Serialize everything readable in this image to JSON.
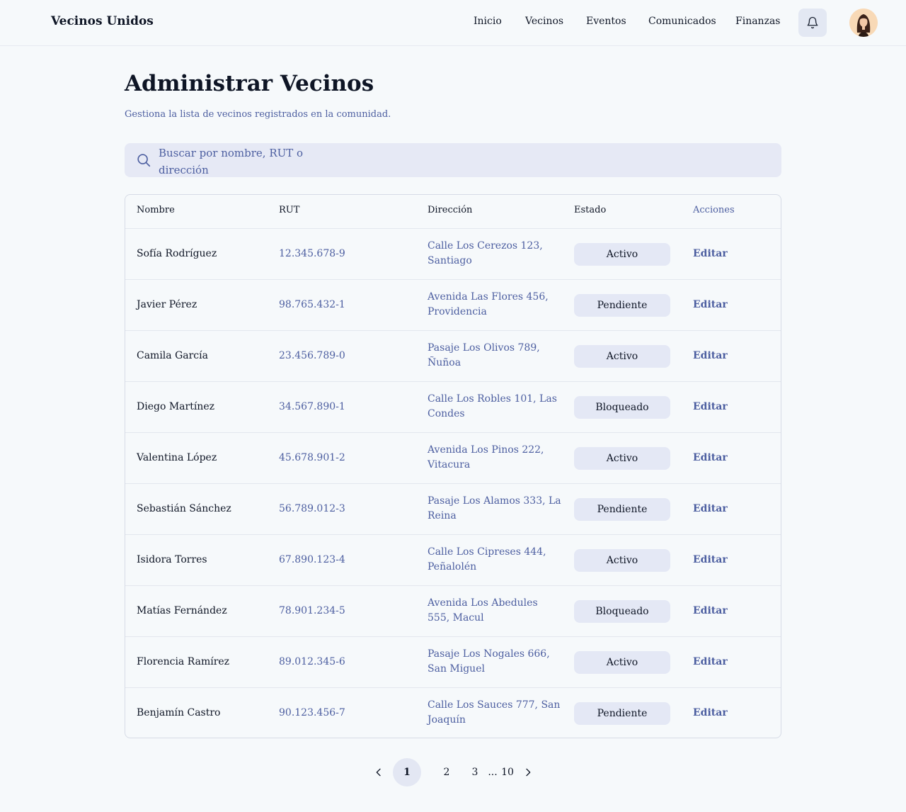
{
  "header": {
    "brand": "Vecinos Unidos",
    "nav": [
      "Inicio",
      "Vecinos",
      "Eventos",
      "Comunicados",
      "Finanzas"
    ],
    "bell_icon": "bell-icon",
    "avatar_icon": "user-avatar"
  },
  "page": {
    "title": "Administrar Vecinos",
    "subtitle": "Gestiona la lista de vecinos registrados en la comunidad.",
    "search_placeholder": "Buscar  por nombre, RUT o dirección"
  },
  "table": {
    "headers": [
      "Nombre",
      "RUT",
      "Dirección",
      "Estado",
      "Acciones"
    ],
    "rows": [
      {
        "name": "Sofía Rodríguez",
        "rut": "12.345.678-9",
        "address": "Calle Los Cerezos 123, Santiago",
        "status": "Activo",
        "action": "Editar"
      },
      {
        "name": "Javier Pérez",
        "rut": "98.765.432-1",
        "address": "Avenida Las Flores 456, Providencia",
        "status": "Pendiente",
        "action": "Editar"
      },
      {
        "name": "Camila García",
        "rut": "23.456.789-0",
        "address": "Pasaje Los Olivos 789, Ñuñoa",
        "status": "Activo",
        "action": "Editar"
      },
      {
        "name": "Diego Martínez",
        "rut": "34.567.890-1",
        "address": "Calle Los Robles 101, Las Condes",
        "status": "Bloqueado",
        "action": "Editar"
      },
      {
        "name": "Valentina López",
        "rut": "45.678.901-2",
        "address": "Avenida Los Pinos 222, Vitacura",
        "status": "Activo",
        "action": "Editar"
      },
      {
        "name": "Sebastián Sánchez",
        "rut": "56.789.012-3",
        "address": "Pasaje Los Alamos 333, La Reina",
        "status": "Pendiente",
        "action": "Editar"
      },
      {
        "name": "Isidora Torres",
        "rut": "67.890.123-4",
        "address": "Calle Los Cipreses 444, Peñalolén",
        "status": "Activo",
        "action": "Editar"
      },
      {
        "name": "Matías Fernández",
        "rut": "78.901.234-5",
        "address": "Avenida Los Abedules 555, Macul",
        "status": "Bloqueado",
        "action": "Editar"
      },
      {
        "name": "Florencia Ramírez",
        "rut": "89.012.345-6",
        "address": "Pasaje Los Nogales 666, San Miguel",
        "status": "Activo",
        "action": "Editar"
      },
      {
        "name": "Benjamín Castro",
        "rut": "90.123.456-7",
        "address": "Calle Los Sauces 777, San Joaquín",
        "status": "Pendiente",
        "action": "Editar"
      }
    ]
  },
  "pagination": {
    "pages": [
      "1",
      "2",
      "3"
    ],
    "ellipsis": "...",
    "last": "10",
    "current": "1"
  }
}
